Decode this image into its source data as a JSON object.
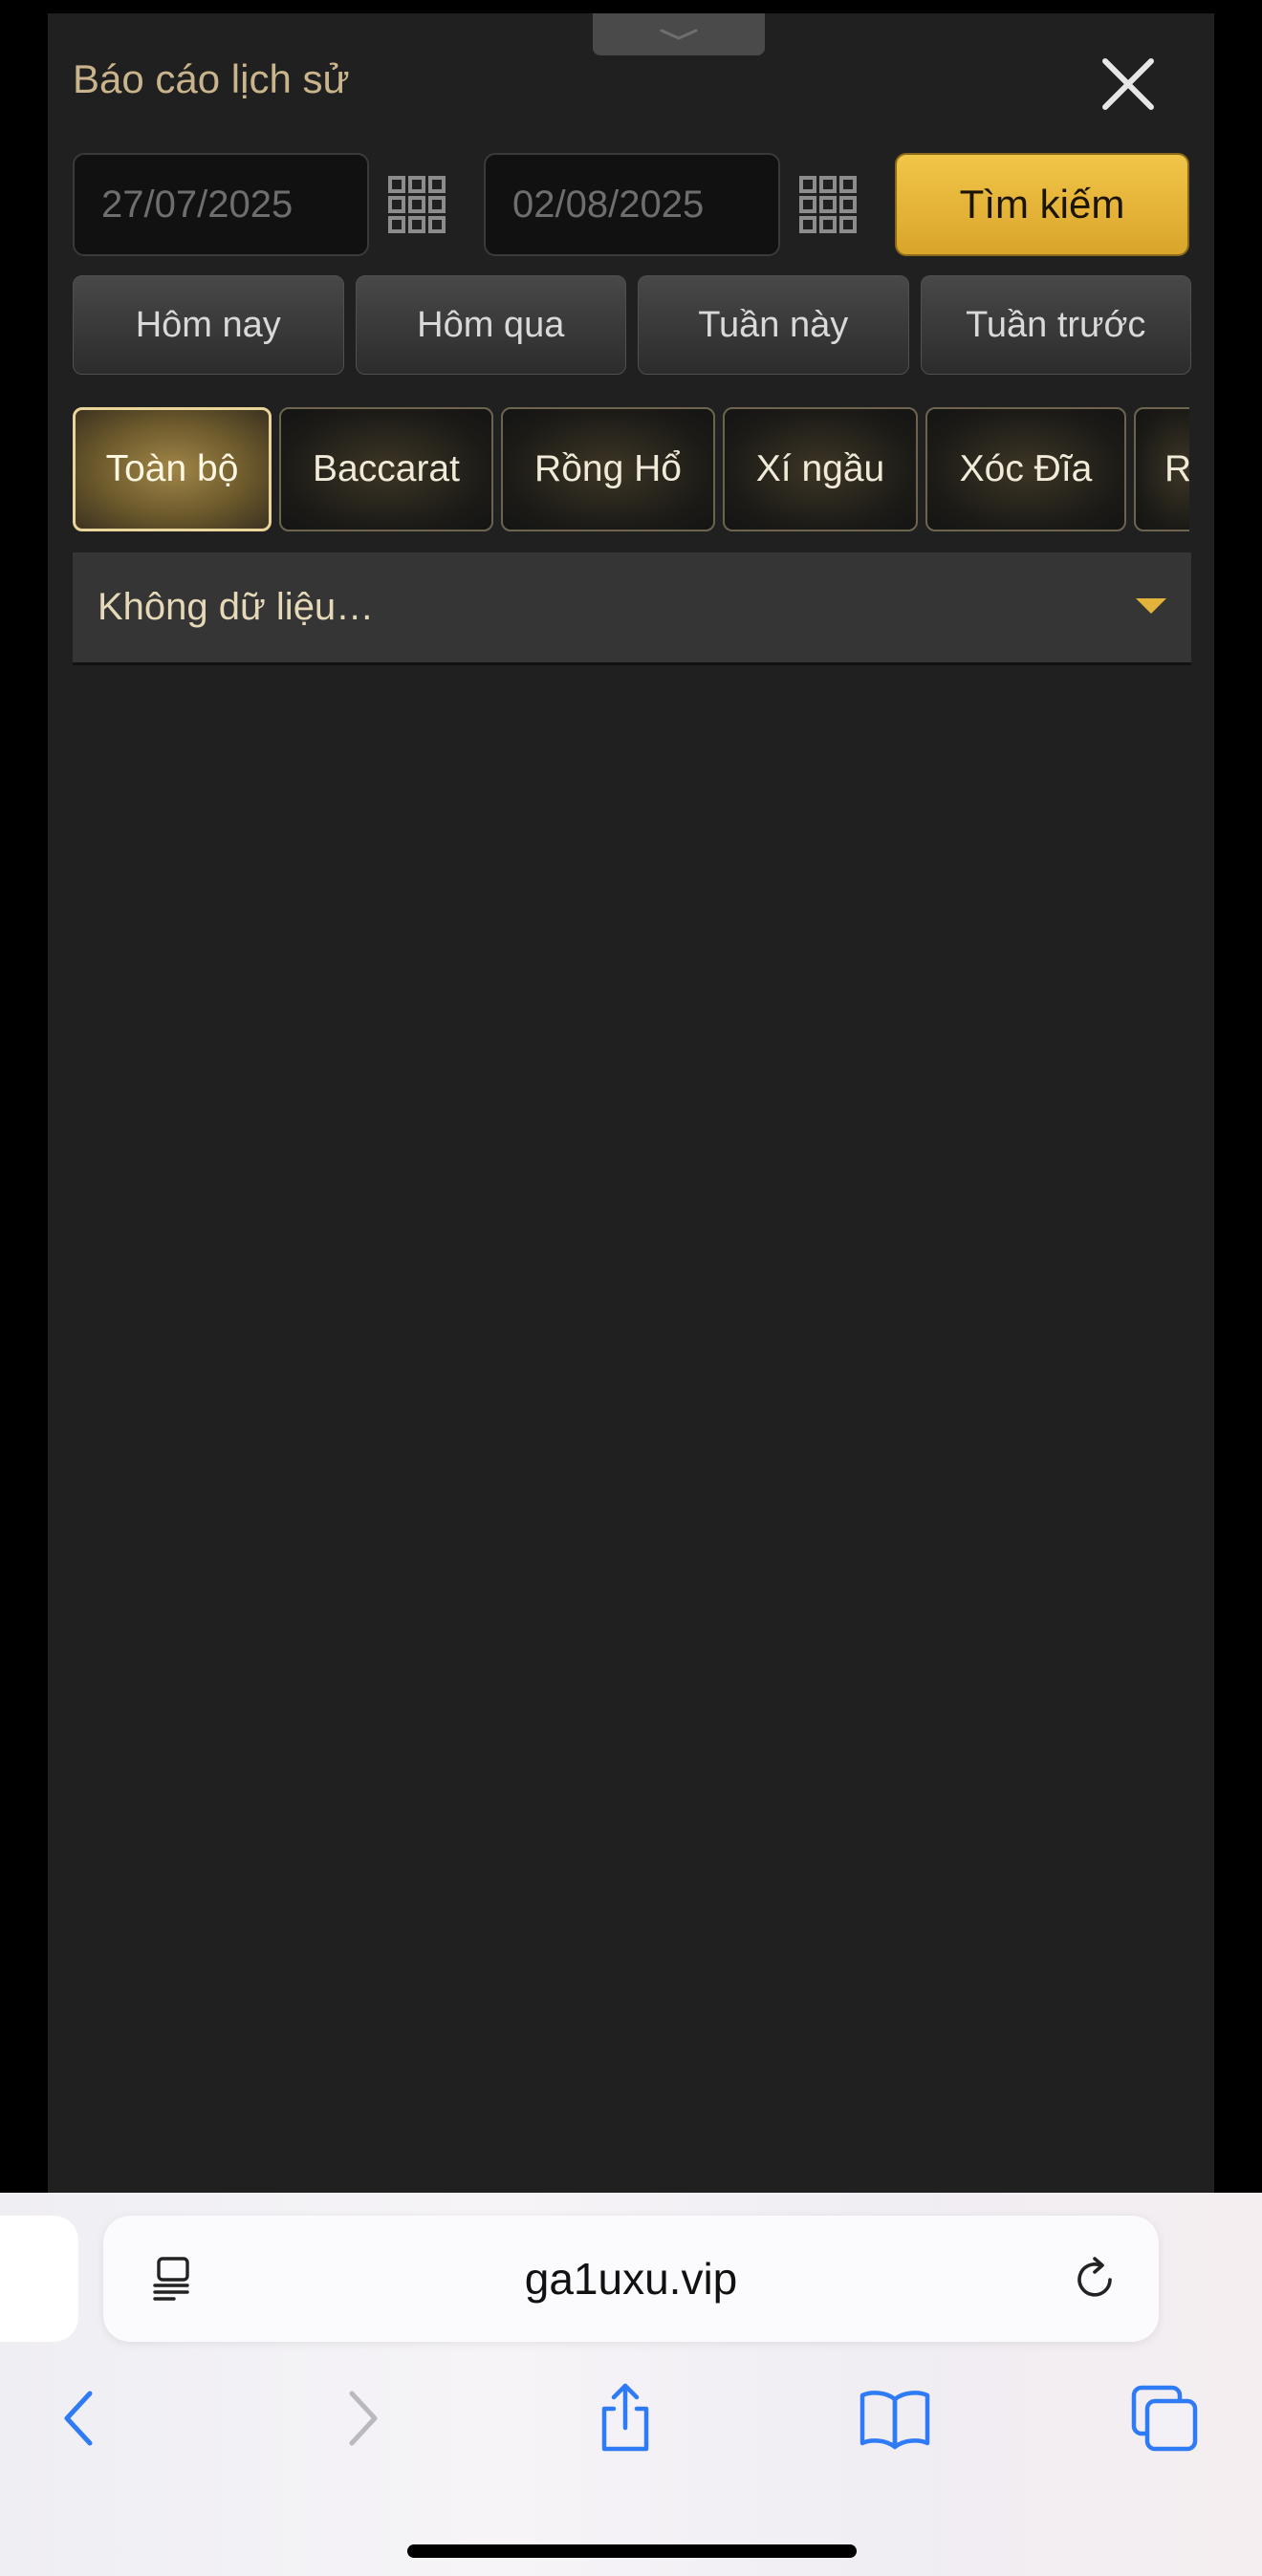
{
  "modal": {
    "title": "Báo cáo lịch sử",
    "date_from": "27/07/2025",
    "date_to": "02/08/2025",
    "search_label": "Tìm kiếm",
    "quick_ranges": [
      "Hôm nay",
      "Hôm qua",
      "Tuần này",
      "Tuần trước"
    ],
    "categories": [
      {
        "label": "Toàn bộ",
        "active": true
      },
      {
        "label": "Baccarat",
        "active": false
      },
      {
        "label": "Rồng Hổ",
        "active": false
      },
      {
        "label": "Xí ngầu",
        "active": false
      },
      {
        "label": "Xóc Đĩa",
        "active": false
      },
      {
        "label": "R",
        "active": false
      }
    ],
    "dropdown_text": "Không dữ liệu…"
  },
  "browser": {
    "url": "ga1uxu.vip",
    "icons": [
      "reader-icon",
      "reload-icon",
      "back-icon",
      "forward-icon",
      "share-icon",
      "bookmarks-icon",
      "tabs-icon"
    ]
  },
  "colors": {
    "panel_bg": "#202020",
    "accent_gold": "#e2b53a",
    "title_color": "#c9b48c",
    "ios_blue": "#2f7bf5"
  }
}
